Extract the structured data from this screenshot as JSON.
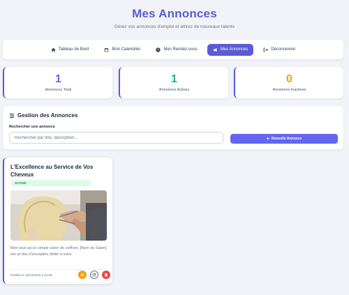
{
  "header": {
    "title": "Mes Annonces",
    "subtitle": "Gérez vos annonces d'emploi et attirez de nouveaux talents"
  },
  "nav": {
    "items": [
      {
        "label": "Tableau de Bord",
        "icon": "home-icon"
      },
      {
        "label": "Mon Calendrier",
        "icon": "calendar-icon"
      },
      {
        "label": "Mes Rendez-vous",
        "icon": "clock-icon"
      },
      {
        "label": "Mes Annonces",
        "icon": "megaphone-icon",
        "active": true
      },
      {
        "label": "Déconnexion",
        "icon": "logout-icon"
      }
    ]
  },
  "stats": [
    {
      "value": "1",
      "label": "Annonces Total",
      "color": "#6366f1"
    },
    {
      "value": "1",
      "label": "Annonces Actives",
      "color": "#10b981"
    },
    {
      "value": "0",
      "label": "Annonces Inactives",
      "color": "#f59e0b"
    }
  ],
  "manage": {
    "title": "Gestion des Annonces",
    "search_label": "Rechercher une annonce",
    "search_placeholder": "Rechercher par titre, description...",
    "search_value": "",
    "new_button": "Nouvelle Annonce"
  },
  "announcements": [
    {
      "title": "L'Excellence au Service de Vos Cheveux",
      "status": "ACTIVE",
      "description": "Bien plus qu'un simple salon de coiffure, [Nom du Salon] est un lieu d'exception dédié à votre",
      "published": "Publiée le 15/10/2025 à 23:08"
    }
  ],
  "colors": {
    "accent": "#5b5bd6",
    "button": "#6366f1",
    "warning": "#f59e0b",
    "danger": "#ef4444"
  }
}
